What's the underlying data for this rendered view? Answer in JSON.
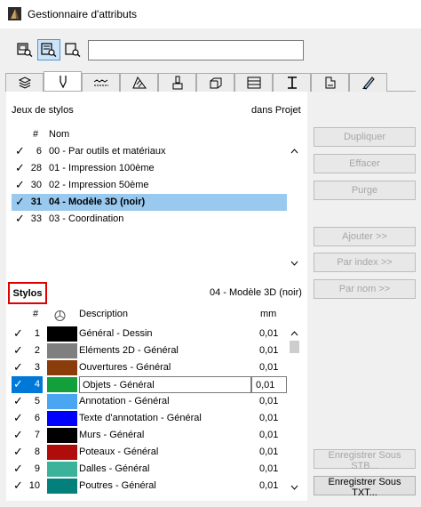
{
  "window": {
    "title": "Gestionnaire d'attributs"
  },
  "toolbar": {
    "view_buttons": [
      {
        "icon": "list-view-icon",
        "active": false
      },
      {
        "icon": "detail-view-icon",
        "active": true
      },
      {
        "icon": "preview-view-icon",
        "active": false
      }
    ],
    "search_value": ""
  },
  "tabs": [
    {
      "icon": "layers-icon",
      "active": false
    },
    {
      "icon": "pen-icon",
      "active": true
    },
    {
      "icon": "line-type-icon",
      "active": false
    },
    {
      "icon": "fill-icon",
      "active": false
    },
    {
      "icon": "surface-brush-icon",
      "active": false
    },
    {
      "icon": "building-material-icon",
      "active": false
    },
    {
      "icon": "composite-icon",
      "active": false
    },
    {
      "icon": "profile-icon",
      "active": false
    },
    {
      "icon": "zone-category-icon",
      "active": false
    },
    {
      "icon": "pen-gradient-icon",
      "active": false
    }
  ],
  "pen_sets": {
    "label": "Jeux de stylos",
    "location": "dans Projet",
    "headers": {
      "hash": "#",
      "name": "Nom"
    },
    "rows": [
      {
        "checked": true,
        "num": "6",
        "name": "00 - Par outils et matériaux",
        "selected": false
      },
      {
        "checked": true,
        "num": "28",
        "name": "01 - Impression 100ème",
        "selected": false
      },
      {
        "checked": true,
        "num": "30",
        "name": "02 - Impression 50ème",
        "selected": false
      },
      {
        "checked": true,
        "num": "31",
        "name": "04 - Modèle 3D (noir)",
        "selected": true
      },
      {
        "checked": true,
        "num": "33",
        "name": "03 - Coordination",
        "selected": false
      }
    ]
  },
  "pens": {
    "label": "Stylos",
    "current_set": "04 - Modèle 3D (noir)",
    "headers": {
      "hash": "#",
      "description": "Description",
      "mm": "mm"
    },
    "rows": [
      {
        "checked": true,
        "num": "1",
        "color": "#000000",
        "description": "Général - Dessin",
        "mm": "0,01"
      },
      {
        "checked": true,
        "num": "2",
        "color": "#7f7f7f",
        "description": "Eléments 2D - Général",
        "mm": "0,01"
      },
      {
        "checked": true,
        "num": "3",
        "color": "#8b3c0b",
        "description": "Ouvertures - Général",
        "mm": "0,01"
      },
      {
        "checked": true,
        "num": "4",
        "color": "#12a03a",
        "description": "Objets - Général",
        "mm": "0,01",
        "editing": true
      },
      {
        "checked": true,
        "num": "5",
        "color": "#4aa6f1",
        "description": "Annotation - Général",
        "mm": "0,01"
      },
      {
        "checked": true,
        "num": "6",
        "color": "#0000ff",
        "description": "Texte d'annotation - Général",
        "mm": "0,01"
      },
      {
        "checked": true,
        "num": "7",
        "color": "#000000",
        "description": "Murs - Général",
        "mm": "0,01"
      },
      {
        "checked": true,
        "num": "8",
        "color": "#b00c0c",
        "description": "Poteaux - Général",
        "mm": "0,01"
      },
      {
        "checked": true,
        "num": "9",
        "color": "#3bb29a",
        "description": "Dalles - Général",
        "mm": "0,01"
      },
      {
        "checked": true,
        "num": "10",
        "color": "#037f7c",
        "description": "Poutres - Général",
        "mm": "0,01"
      }
    ]
  },
  "buttons": {
    "duplicate": "Dupliquer",
    "delete": "Effacer",
    "purge": "Purge",
    "add": "Ajouter >>",
    "by_index": "Par index >>",
    "by_name": "Par nom >>",
    "save_stb": "Enregistrer Sous STB...",
    "save_txt": "Enregistrer Sous TXT..."
  }
}
